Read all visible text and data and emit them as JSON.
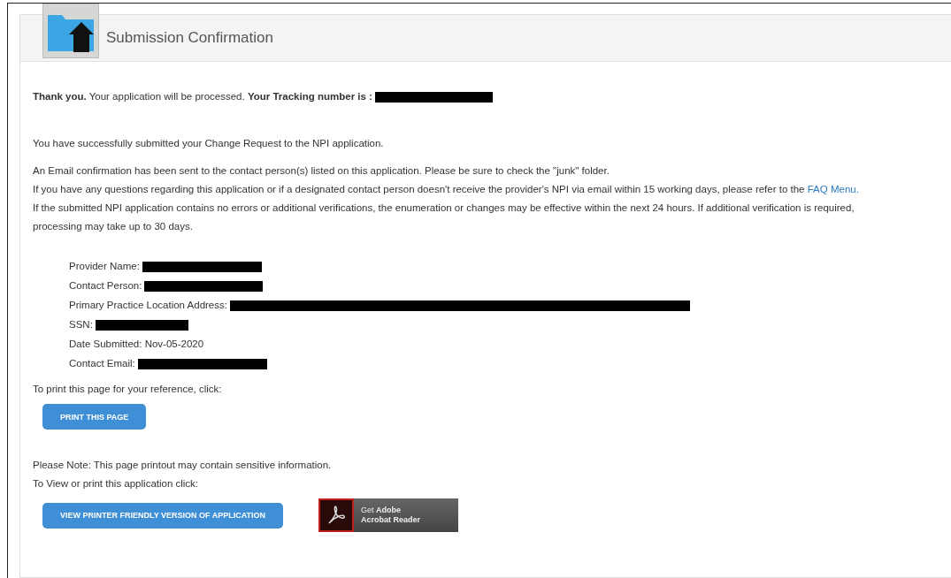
{
  "header": {
    "title": "Submission Confirmation"
  },
  "thank_you": {
    "text": "**Thank you.** Your application will be processed. **Your Tracking number is :**",
    "redacted": true
  },
  "intro": "You have successfully submitted your Change Request to the NPI application.",
  "notices": [
    {
      "text": "An Email confirmation has been sent to the contact person(s) listed on this application. Please be sure to check the \"junk\" folder."
    },
    {
      "text": "If you have any questions regarding this application or if a designated contact person doesn't receive the provider's NPI via email within 15 working days,  please refer to the",
      "link": "FAQ Menu."
    },
    {
      "text": "If the submitted NPI application contains no errors or additional verifications, the enumeration or changes may be effective within the next 24 hours. If additional verification is required, processing may take up to 30 days."
    }
  ],
  "details": [
    {
      "label": "Provider Name:",
      "redacted": true
    },
    {
      "label": "Contact Person:",
      "redacted": true
    },
    {
      "label": "Primary Practice Location Address:",
      "redacted": true
    },
    {
      "label": "SSN:",
      "redacted": true
    },
    {
      "label": "Date Submitted: Nov-05-2020",
      "redacted": false
    },
    {
      "label": "Contact Email:",
      "redacted": true
    }
  ],
  "print_prompt": "To print this page for your reference, click:",
  "print_button": "PRINT THIS PAGE",
  "note": "Please Note: This page printout may contain sensitive information.",
  "view_prompt": "To View or print this application click:",
  "view_button": "VIEW PRINTER FRIENDLY VERSION OF APPLICATION",
  "adobe_badge": {
    "line_1": "Get **Adobe**",
    "line_2": "Acrobat Reader"
  }
}
